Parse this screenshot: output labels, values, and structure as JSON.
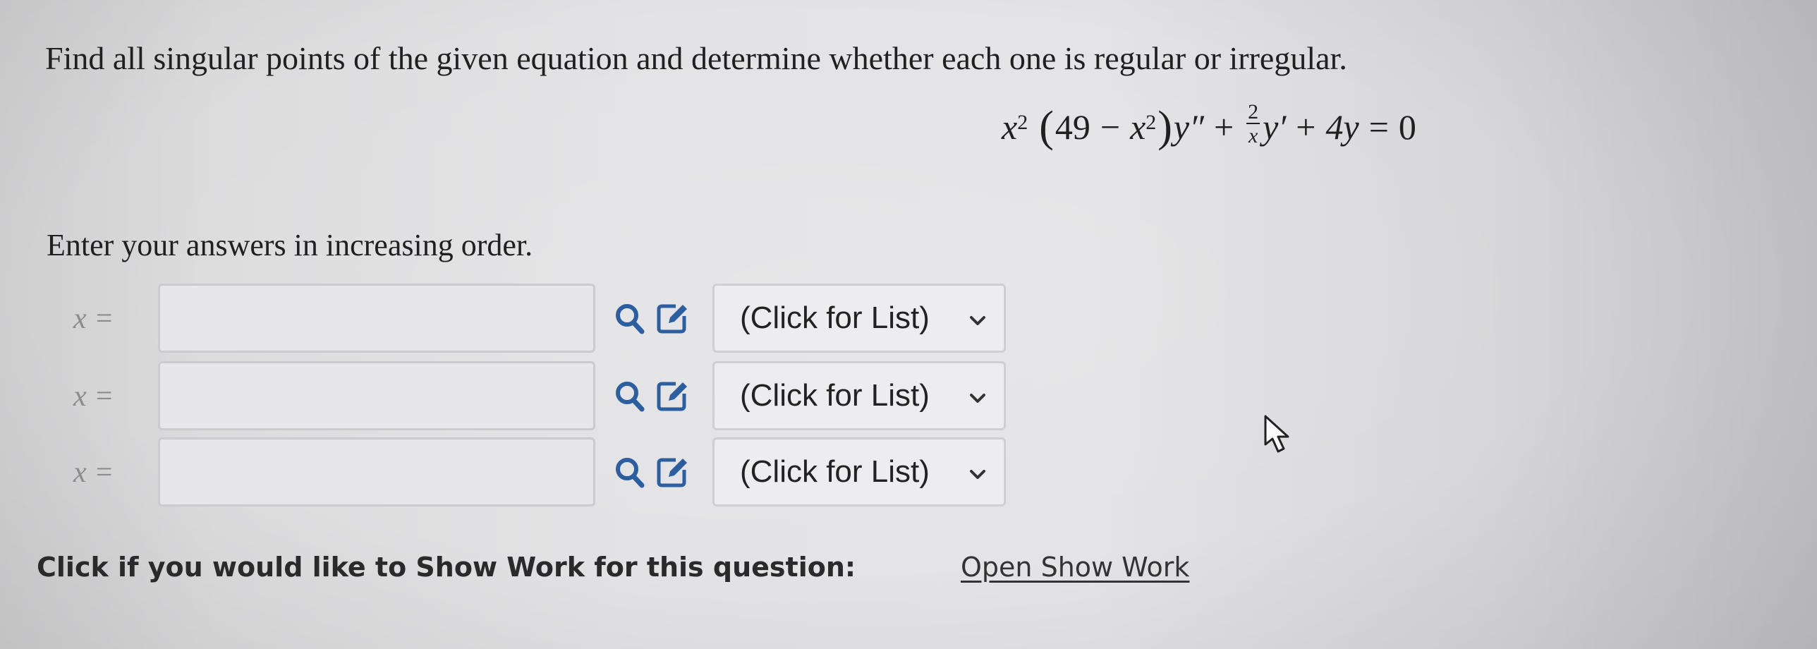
{
  "question": {
    "prompt": "Find all singular points of the given equation and determine whether each one is regular or irregular.",
    "equation": {
      "x": "x",
      "exp2": "2",
      "open_paren": "(",
      "const": "49",
      "minus": "−",
      "close_paren": ")",
      "ypp": "y″",
      "plus": "+",
      "frac_num": "2",
      "frac_den": "x",
      "yp": "y′",
      "term3": "4y",
      "equals": "=",
      "rhs": "0"
    },
    "instruction": "Enter your answers in increasing order."
  },
  "answers": [
    {
      "label": "x =",
      "value": "",
      "select_label": "(Click for List)"
    },
    {
      "label": "x =",
      "value": "",
      "select_label": "(Click for List)"
    },
    {
      "label": "x =",
      "value": "",
      "select_label": "(Click for List)"
    }
  ],
  "icons": {
    "search": "search-icon",
    "edit": "edit-icon",
    "chevron": "chevron-down-icon",
    "cursor": "mouse-cursor-icon"
  },
  "colors": {
    "accent": "#2d5fa0",
    "background": "#e2e2e4"
  },
  "show_work": {
    "prompt": "Click if you would like to Show Work for this question:",
    "link_label": "Open Show Work"
  }
}
